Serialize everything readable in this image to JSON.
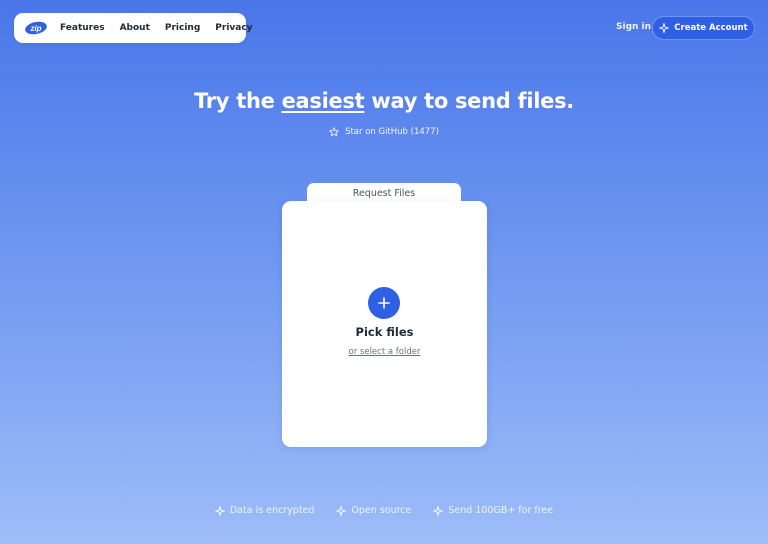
{
  "nav": {
    "logo_text": "zip",
    "links": [
      "Features",
      "About",
      "Pricing",
      "Privacy"
    ],
    "sign_in": "Sign in",
    "create_account": "Create Account"
  },
  "hero": {
    "title_before": "Try the ",
    "title_emphasis": "easiest",
    "title_after": " way to send files.",
    "github_star": "Star on GitHub (1477)"
  },
  "upload": {
    "tab_label": "Request Files",
    "pick_files": "Pick files",
    "select_folder": "or select a folder"
  },
  "features": [
    "Data is encrypted",
    "Open source",
    "Send 100GB+ for free"
  ],
  "colors": {
    "accent": "#2f5fe3",
    "background_top": "#4a76ea",
    "background_bottom": "#9dbcf8"
  },
  "icons": {
    "logo": "zip-logo-icon",
    "star": "star-icon",
    "sparkle": "sparkle-icon",
    "plus": "plus-icon"
  }
}
